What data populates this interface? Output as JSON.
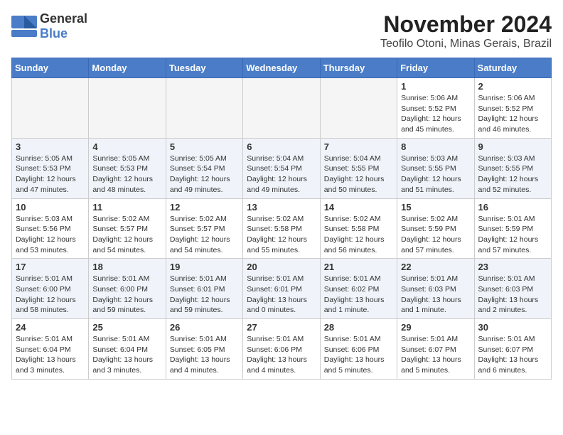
{
  "logo": {
    "general": "General",
    "blue": "Blue"
  },
  "title": "November 2024",
  "location": "Teofilo Otoni, Minas Gerais, Brazil",
  "headers": [
    "Sunday",
    "Monday",
    "Tuesday",
    "Wednesday",
    "Thursday",
    "Friday",
    "Saturday"
  ],
  "weeks": [
    [
      {
        "day": "",
        "info": ""
      },
      {
        "day": "",
        "info": ""
      },
      {
        "day": "",
        "info": ""
      },
      {
        "day": "",
        "info": ""
      },
      {
        "day": "",
        "info": ""
      },
      {
        "day": "1",
        "info": "Sunrise: 5:06 AM\nSunset: 5:52 PM\nDaylight: 12 hours\nand 45 minutes."
      },
      {
        "day": "2",
        "info": "Sunrise: 5:06 AM\nSunset: 5:52 PM\nDaylight: 12 hours\nand 46 minutes."
      }
    ],
    [
      {
        "day": "3",
        "info": "Sunrise: 5:05 AM\nSunset: 5:53 PM\nDaylight: 12 hours\nand 47 minutes."
      },
      {
        "day": "4",
        "info": "Sunrise: 5:05 AM\nSunset: 5:53 PM\nDaylight: 12 hours\nand 48 minutes."
      },
      {
        "day": "5",
        "info": "Sunrise: 5:05 AM\nSunset: 5:54 PM\nDaylight: 12 hours\nand 49 minutes."
      },
      {
        "day": "6",
        "info": "Sunrise: 5:04 AM\nSunset: 5:54 PM\nDaylight: 12 hours\nand 49 minutes."
      },
      {
        "day": "7",
        "info": "Sunrise: 5:04 AM\nSunset: 5:55 PM\nDaylight: 12 hours\nand 50 minutes."
      },
      {
        "day": "8",
        "info": "Sunrise: 5:03 AM\nSunset: 5:55 PM\nDaylight: 12 hours\nand 51 minutes."
      },
      {
        "day": "9",
        "info": "Sunrise: 5:03 AM\nSunset: 5:55 PM\nDaylight: 12 hours\nand 52 minutes."
      }
    ],
    [
      {
        "day": "10",
        "info": "Sunrise: 5:03 AM\nSunset: 5:56 PM\nDaylight: 12 hours\nand 53 minutes."
      },
      {
        "day": "11",
        "info": "Sunrise: 5:02 AM\nSunset: 5:57 PM\nDaylight: 12 hours\nand 54 minutes."
      },
      {
        "day": "12",
        "info": "Sunrise: 5:02 AM\nSunset: 5:57 PM\nDaylight: 12 hours\nand 54 minutes."
      },
      {
        "day": "13",
        "info": "Sunrise: 5:02 AM\nSunset: 5:58 PM\nDaylight: 12 hours\nand 55 minutes."
      },
      {
        "day": "14",
        "info": "Sunrise: 5:02 AM\nSunset: 5:58 PM\nDaylight: 12 hours\nand 56 minutes."
      },
      {
        "day": "15",
        "info": "Sunrise: 5:02 AM\nSunset: 5:59 PM\nDaylight: 12 hours\nand 57 minutes."
      },
      {
        "day": "16",
        "info": "Sunrise: 5:01 AM\nSunset: 5:59 PM\nDaylight: 12 hours\nand 57 minutes."
      }
    ],
    [
      {
        "day": "17",
        "info": "Sunrise: 5:01 AM\nSunset: 6:00 PM\nDaylight: 12 hours\nand 58 minutes."
      },
      {
        "day": "18",
        "info": "Sunrise: 5:01 AM\nSunset: 6:00 PM\nDaylight: 12 hours\nand 59 minutes."
      },
      {
        "day": "19",
        "info": "Sunrise: 5:01 AM\nSunset: 6:01 PM\nDaylight: 12 hours\nand 59 minutes."
      },
      {
        "day": "20",
        "info": "Sunrise: 5:01 AM\nSunset: 6:01 PM\nDaylight: 13 hours\nand 0 minutes."
      },
      {
        "day": "21",
        "info": "Sunrise: 5:01 AM\nSunset: 6:02 PM\nDaylight: 13 hours\nand 1 minute."
      },
      {
        "day": "22",
        "info": "Sunrise: 5:01 AM\nSunset: 6:03 PM\nDaylight: 13 hours\nand 1 minute."
      },
      {
        "day": "23",
        "info": "Sunrise: 5:01 AM\nSunset: 6:03 PM\nDaylight: 13 hours\nand 2 minutes."
      }
    ],
    [
      {
        "day": "24",
        "info": "Sunrise: 5:01 AM\nSunset: 6:04 PM\nDaylight: 13 hours\nand 3 minutes."
      },
      {
        "day": "25",
        "info": "Sunrise: 5:01 AM\nSunset: 6:04 PM\nDaylight: 13 hours\nand 3 minutes."
      },
      {
        "day": "26",
        "info": "Sunrise: 5:01 AM\nSunset: 6:05 PM\nDaylight: 13 hours\nand 4 minutes."
      },
      {
        "day": "27",
        "info": "Sunrise: 5:01 AM\nSunset: 6:06 PM\nDaylight: 13 hours\nand 4 minutes."
      },
      {
        "day": "28",
        "info": "Sunrise: 5:01 AM\nSunset: 6:06 PM\nDaylight: 13 hours\nand 5 minutes."
      },
      {
        "day": "29",
        "info": "Sunrise: 5:01 AM\nSunset: 6:07 PM\nDaylight: 13 hours\nand 5 minutes."
      },
      {
        "day": "30",
        "info": "Sunrise: 5:01 AM\nSunset: 6:07 PM\nDaylight: 13 hours\nand 6 minutes."
      }
    ]
  ]
}
